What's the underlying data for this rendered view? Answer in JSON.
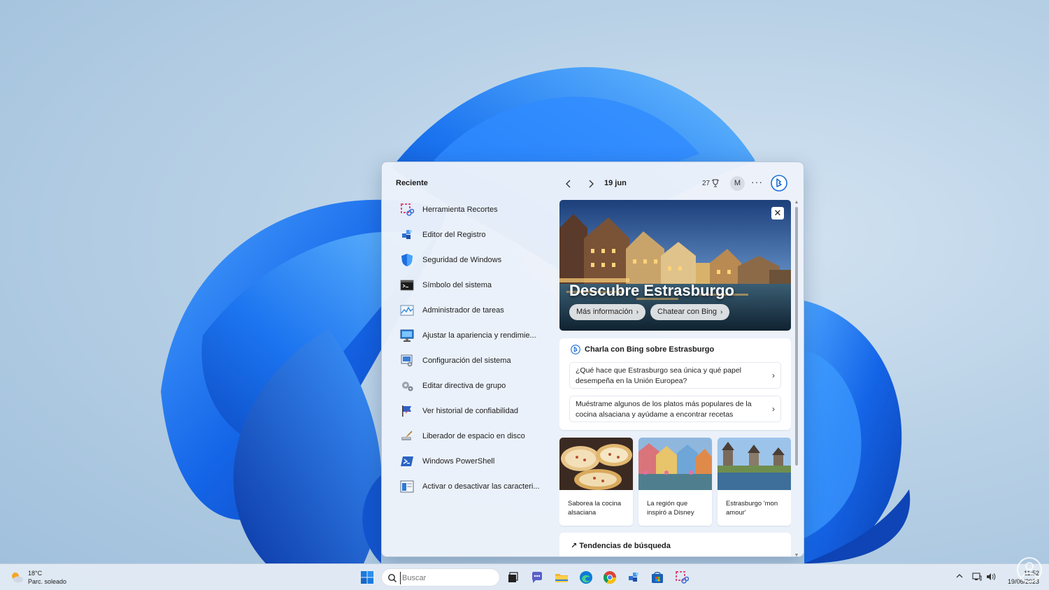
{
  "colors": {
    "accent": "#0067c0",
    "panel_bg": "#ecf2fa",
    "wallpaper_blue": "#1a6fe6"
  },
  "panel": {
    "recent": {
      "title": "Reciente",
      "items": [
        {
          "label": "Herramienta Recortes",
          "icon": "snipping-tool-icon"
        },
        {
          "label": "Editor del Registro",
          "icon": "registry-editor-icon"
        },
        {
          "label": "Seguridad de Windows",
          "icon": "windows-security-icon"
        },
        {
          "label": "Símbolo del sistema",
          "icon": "command-prompt-icon"
        },
        {
          "label": "Administrador de tareas",
          "icon": "task-manager-icon"
        },
        {
          "label": "Ajustar la apariencia y rendimie...",
          "icon": "performance-options-icon"
        },
        {
          "label": "Configuración del sistema",
          "icon": "system-configuration-icon"
        },
        {
          "label": "Editar directiva de grupo",
          "icon": "group-policy-icon"
        },
        {
          "label": "Ver historial de confiabilidad",
          "icon": "reliability-history-icon"
        },
        {
          "label": "Liberador de espacio en disco",
          "icon": "disk-cleanup-icon"
        },
        {
          "label": "Windows PowerShell",
          "icon": "powershell-icon"
        },
        {
          "label": "Activar o desactivar las caracteri...",
          "icon": "windows-features-icon"
        }
      ]
    },
    "topbar": {
      "date": "19 jun",
      "points": "27",
      "avatar_initial": "M",
      "more": "···"
    },
    "hero": {
      "title": "Descubre Estrasburgo",
      "primary_button": "Más información",
      "secondary_button": "Chatear con Bing",
      "close": "✕"
    },
    "chat": {
      "title": "Charla con Bing sobre Estrasburgo",
      "questions": [
        "¿Qué hace que Estrasburgo sea única y qué papel desempeña en la Unión Europea?",
        "Muéstrame algunos de los platos más populares de la cocina alsaciana y ayúdame a encontrar recetas"
      ]
    },
    "tiles": [
      {
        "label": "Saborea la cocina alsaciana"
      },
      {
        "label": "La región que inspiró a Disney"
      },
      {
        "label": "Estrasburgo 'mon amour'"
      }
    ],
    "trends": {
      "title": "Tendencias de búsqueda"
    }
  },
  "taskbar": {
    "weather": {
      "temp": "18°C",
      "condition": "Parc. soleado"
    },
    "search": {
      "placeholder": "Buscar"
    },
    "clock": {
      "time": "11:52",
      "date": "19/06/2023"
    }
  }
}
